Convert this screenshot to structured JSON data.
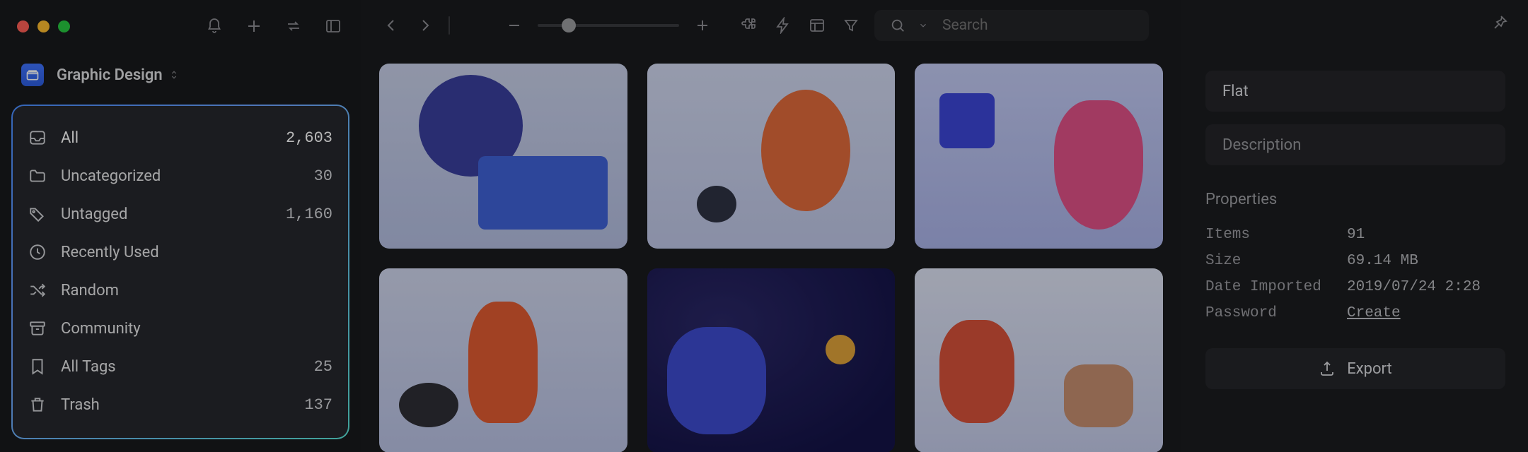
{
  "library": {
    "name": "Graphic Design"
  },
  "smart_folders": [
    {
      "icon": "inbox",
      "label": "All",
      "count": "2,603"
    },
    {
      "icon": "folder",
      "label": "Uncategorized",
      "count": "30"
    },
    {
      "icon": "tag",
      "label": "Untagged",
      "count": "1,160"
    },
    {
      "icon": "clock",
      "label": "Recently Used",
      "count": ""
    },
    {
      "icon": "shuffle",
      "label": "Random",
      "count": ""
    },
    {
      "icon": "archive",
      "label": "Community",
      "count": ""
    },
    {
      "icon": "bookmark",
      "label": "All Tags",
      "count": "25"
    },
    {
      "icon": "trash",
      "label": "Trash",
      "count": "137"
    }
  ],
  "toolbar": {
    "zoom_percent": 22
  },
  "search": {
    "placeholder": "Search"
  },
  "inspector": {
    "title_value": "Flat",
    "description_placeholder": "Description",
    "section_label": "Properties",
    "rows": {
      "items_label": "Items",
      "items_value": "91",
      "size_label": "Size",
      "size_value": "69.14 MB",
      "date_label": "Date Imported",
      "date_value": "2019/07/24 2:28",
      "password_label": "Password",
      "password_action": "Create"
    },
    "export_label": "Export"
  }
}
